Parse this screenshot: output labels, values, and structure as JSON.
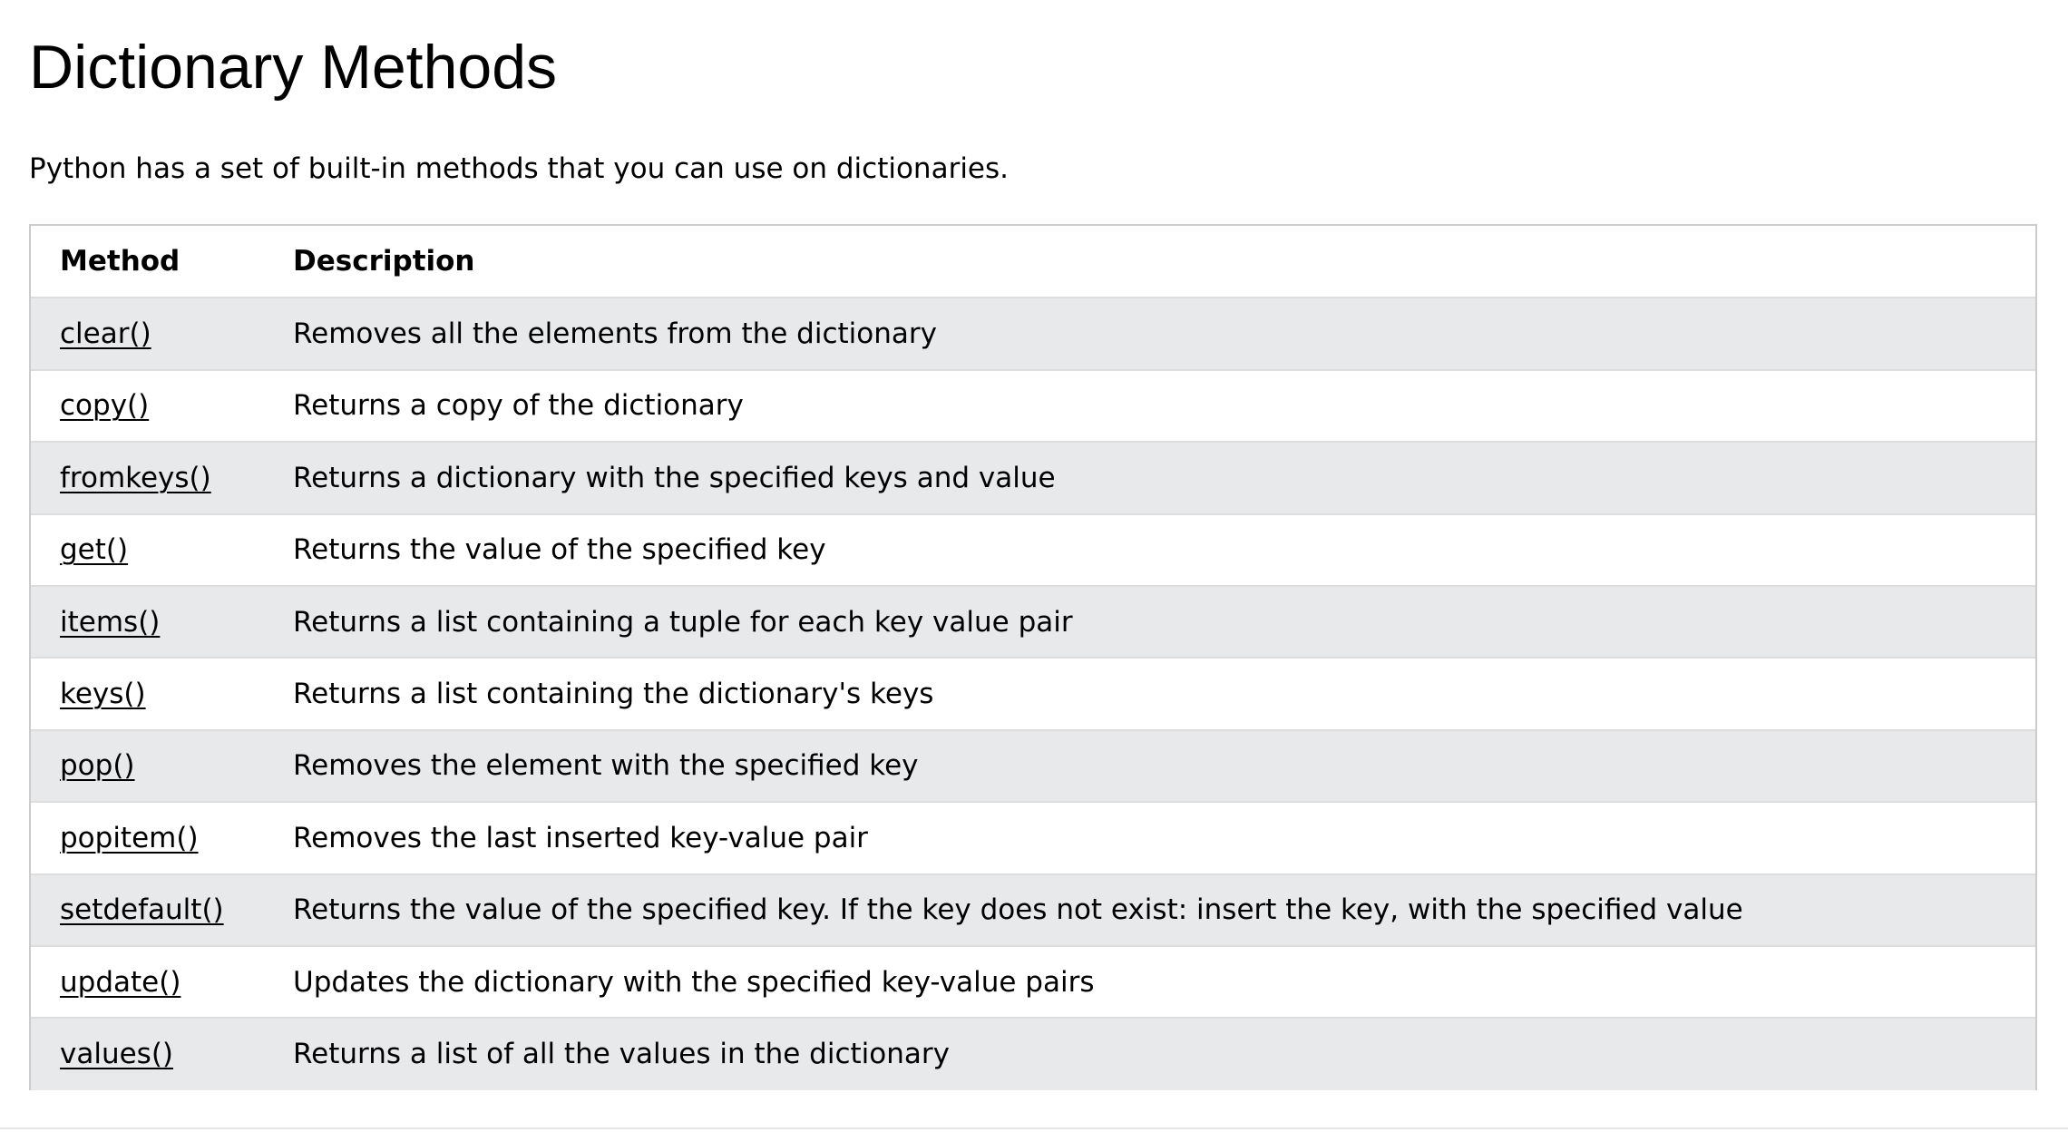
{
  "page": {
    "title": "Dictionary Methods",
    "intro": "Python has a set of built-in methods that you can use on dictionaries."
  },
  "table": {
    "headers": [
      "Method",
      "Description"
    ],
    "rows": [
      {
        "method": "clear()",
        "description": "Removes all the elements from the dictionary"
      },
      {
        "method": "copy()",
        "description": "Returns a copy of the dictionary"
      },
      {
        "method": "fromkeys()",
        "description": "Returns a dictionary with the specified keys and value"
      },
      {
        "method": "get()",
        "description": "Returns the value of the specified key"
      },
      {
        "method": "items()",
        "description": "Returns a list containing a tuple for each key value pair"
      },
      {
        "method": "keys()",
        "description": "Returns a list containing the dictionary's keys"
      },
      {
        "method": "pop()",
        "description": "Removes the element with the specified key"
      },
      {
        "method": "popitem()",
        "description": "Removes the last inserted key-value pair"
      },
      {
        "method": "setdefault()",
        "description": "Returns the value of the specified key. If the key does not exist: insert the key, with the specified value"
      },
      {
        "method": "update()",
        "description": "Updates the dictionary with the specified key-value pairs"
      },
      {
        "method": "values()",
        "description": "Returns a list of all the values in the dictionary"
      }
    ]
  },
  "colors": {
    "striped_row": "#e7e9eb",
    "border": "#cccccc",
    "text": "#000000"
  }
}
